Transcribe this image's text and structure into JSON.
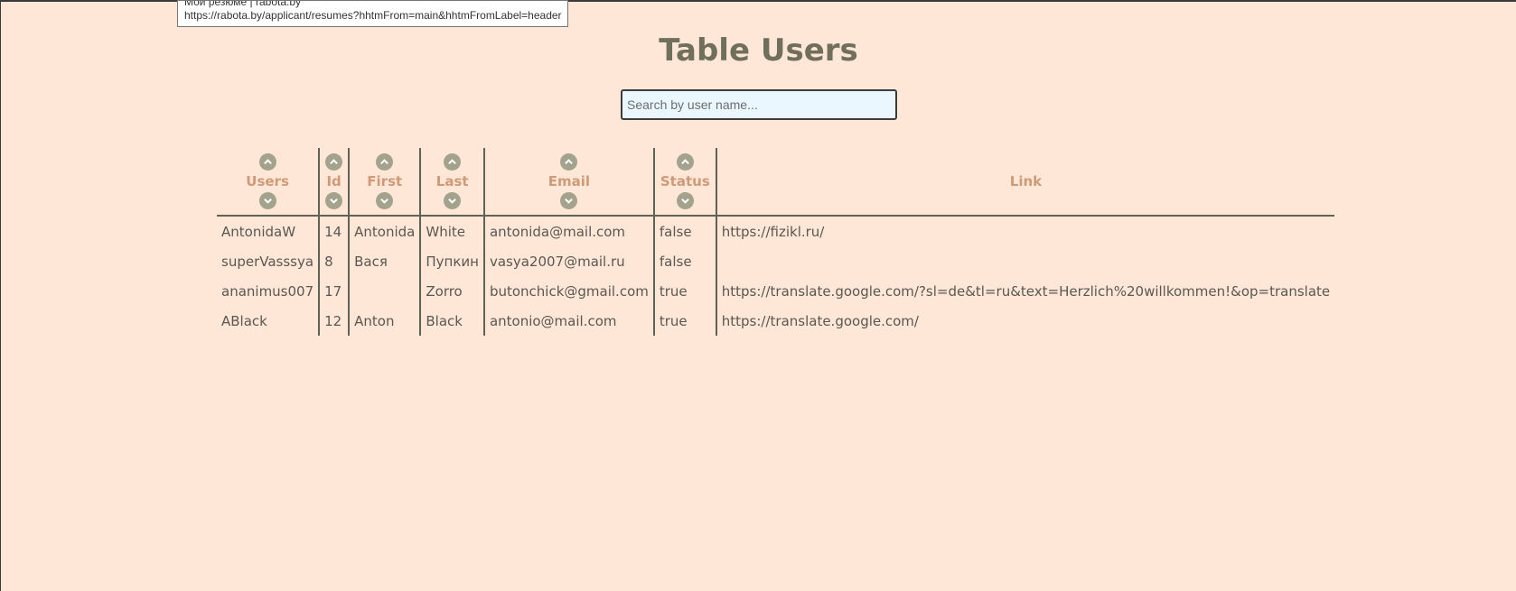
{
  "tooltip": {
    "title": "Мои резюме | rabota.by",
    "url": "https://rabota.by/applicant/resumes?hhtmFrom=main&hhtmFromLabel=header"
  },
  "page": {
    "title": "Table Users"
  },
  "search": {
    "placeholder": "Search by user name...",
    "value": ""
  },
  "table": {
    "columns": [
      "Users",
      "Id",
      "First",
      "Last",
      "Email",
      "Status",
      "Link"
    ],
    "sortable": [
      true,
      true,
      true,
      true,
      true,
      true,
      false
    ],
    "rows": [
      [
        "AntonidaW",
        "14",
        "Antonida",
        "White",
        "antonida@mail.com",
        "false",
        "https://fizikl.ru/"
      ],
      [
        "superVasssya",
        "8",
        "Вася",
        "Пупкин",
        "vasya2007@mail.ru",
        "false",
        ""
      ],
      [
        "ananimus007",
        "17",
        "",
        "Zorro",
        "butonchick@gmail.com",
        "true",
        "https://translate.google.com/?sl=de&tl=ru&text=Herzlich%20willkommen!&op=translate"
      ],
      [
        "ABlack",
        "12",
        "Anton",
        "Black",
        "antonio@mail.com",
        "true",
        "https://translate.google.com/"
      ]
    ]
  },
  "colors": {
    "background": "#ffe7d8",
    "header_text": "#cf9a78",
    "title": "#6f6f5c",
    "sort_button": "#a3a28c",
    "search_bg": "#eaf7ff"
  },
  "icons": {
    "sort_asc": "chevron-up-icon",
    "sort_desc": "chevron-down-icon"
  }
}
